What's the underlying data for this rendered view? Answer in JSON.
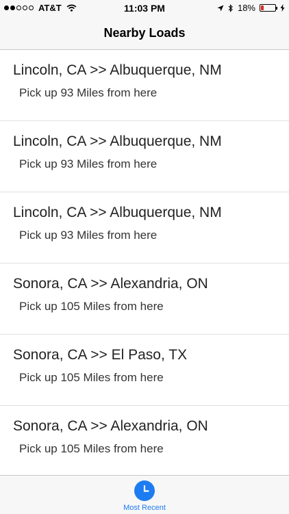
{
  "status_bar": {
    "carrier": "AT&T",
    "time": "11:03 PM",
    "battery_percent": "18%",
    "battery_level": 0.18,
    "signal_bars_filled": 2,
    "signal_bars_total": 5
  },
  "nav": {
    "title": "Nearby Loads"
  },
  "loads": [
    {
      "route": "Lincoln, CA >> Albuquerque, NM",
      "pickup": "Pick up 93 Miles from here"
    },
    {
      "route": "Lincoln, CA >> Albuquerque, NM",
      "pickup": "Pick up 93 Miles from here"
    },
    {
      "route": "Lincoln, CA >> Albuquerque, NM",
      "pickup": "Pick up 93 Miles from here"
    },
    {
      "route": "Sonora, CA >> Alexandria, ON",
      "pickup": "Pick up 105 Miles from here"
    },
    {
      "route": "Sonora, CA >> El Paso, TX",
      "pickup": "Pick up 105 Miles from here"
    },
    {
      "route": "Sonora, CA >> Alexandria, ON",
      "pickup": "Pick up 105 Miles from here"
    }
  ],
  "tab_bar": {
    "items": [
      {
        "label": "Most Recent",
        "icon": "clock-icon",
        "active": true
      }
    ]
  },
  "colors": {
    "accent": "#1e7cf2",
    "battery_low": "#e02424"
  }
}
